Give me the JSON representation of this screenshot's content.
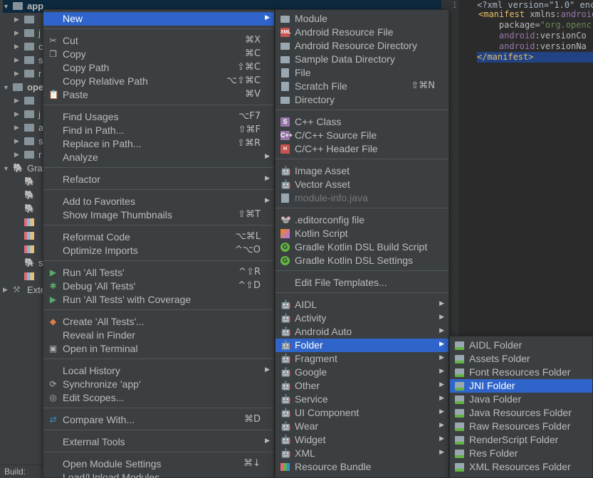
{
  "tree": {
    "rows": [
      {
        "label": "app",
        "kind": "module"
      },
      {
        "label": "",
        "kind": "folder"
      },
      {
        "label": "j",
        "kind": "folder"
      },
      {
        "label": "c",
        "kind": "folder"
      },
      {
        "label": "s",
        "kind": "folder"
      },
      {
        "label": "r",
        "kind": "folder"
      },
      {
        "label": "ope",
        "kind": "module"
      },
      {
        "label": "",
        "kind": "folder"
      },
      {
        "label": "j",
        "kind": "folder"
      },
      {
        "label": "a",
        "kind": "folder"
      },
      {
        "label": "s",
        "kind": "folder"
      },
      {
        "label": "r",
        "kind": "folder"
      },
      {
        "label": "Gra",
        "kind": "gradle"
      },
      {
        "label": "",
        "kind": "gradle-file"
      },
      {
        "label": "",
        "kind": "gradle-file"
      },
      {
        "label": "",
        "kind": "gradle-file"
      },
      {
        "label": "",
        "kind": "bars"
      },
      {
        "label": "",
        "kind": "bars"
      },
      {
        "label": "",
        "kind": "bars"
      },
      {
        "label": "s",
        "kind": "gradle-file"
      },
      {
        "label": "",
        "kind": "bars"
      },
      {
        "label": "Exte",
        "kind": "external"
      }
    ]
  },
  "editor": {
    "line_numbers": [
      "1"
    ],
    "lines": [
      {
        "parts": [
          {
            "t": "<?xml version=\"1.0\" enc",
            "c": "plain"
          }
        ]
      },
      {
        "parts": [
          {
            "t": "<manifest ",
            "c": "tag"
          },
          {
            "t": "xmlns:",
            "c": "attr"
          },
          {
            "t": "android",
            "c": "ns"
          }
        ]
      },
      {
        "parts": [
          {
            "t": "    package=",
            "c": "attr"
          },
          {
            "t": "\"org.openc",
            "c": "str"
          }
        ]
      },
      {
        "parts": [
          {
            "t": "    android",
            "c": "ns"
          },
          {
            "t": ":versionCo",
            "c": "attr"
          }
        ]
      },
      {
        "parts": [
          {
            "t": "    android",
            "c": "ns"
          },
          {
            "t": ":versionNa",
            "c": "attr"
          }
        ]
      },
      {
        "parts": [
          {
            "t": "</manifest>",
            "c": "tag"
          }
        ]
      }
    ]
  },
  "bottombar": {
    "build_label": "Build:"
  },
  "context_menu": {
    "items": [
      {
        "label": "New",
        "icon": "",
        "shortcut": "",
        "submenu": true,
        "active": true
      },
      {
        "sep": true
      },
      {
        "label": "Cut",
        "icon": "scissors-icon",
        "shortcut": "⌘X"
      },
      {
        "label": "Copy",
        "icon": "copy-icon",
        "shortcut": "⌘C"
      },
      {
        "label": "Copy Path",
        "icon": "",
        "shortcut": "⇧⌘C"
      },
      {
        "label": "Copy Relative Path",
        "icon": "",
        "shortcut": "⌥⇧⌘C"
      },
      {
        "label": "Paste",
        "icon": "paste-icon",
        "shortcut": "⌘V"
      },
      {
        "sep": true
      },
      {
        "label": "Find Usages",
        "icon": "",
        "shortcut": "⌥F7"
      },
      {
        "label": "Find in Path...",
        "icon": "",
        "shortcut": "⇧⌘F"
      },
      {
        "label": "Replace in Path...",
        "icon": "",
        "shortcut": "⇧⌘R"
      },
      {
        "label": "Analyze",
        "icon": "",
        "shortcut": "",
        "submenu": true
      },
      {
        "sep": true
      },
      {
        "label": "Refactor",
        "icon": "",
        "shortcut": "",
        "submenu": true
      },
      {
        "sep": true
      },
      {
        "label": "Add to Favorites",
        "icon": "",
        "shortcut": "",
        "submenu": true
      },
      {
        "label": "Show Image Thumbnails",
        "icon": "",
        "shortcut": "⇧⌘T"
      },
      {
        "sep": true
      },
      {
        "label": "Reformat Code",
        "icon": "",
        "shortcut": "⌥⌘L"
      },
      {
        "label": "Optimize Imports",
        "icon": "",
        "shortcut": "^⌥O"
      },
      {
        "sep": true
      },
      {
        "label": "Run 'All Tests'",
        "icon": "run-icon",
        "shortcut": "^⇧R"
      },
      {
        "label": "Debug 'All Tests'",
        "icon": "debug-icon",
        "shortcut": "^⇧D"
      },
      {
        "label": "Run 'All Tests' with Coverage",
        "icon": "coverage-icon",
        "shortcut": ""
      },
      {
        "sep": true
      },
      {
        "label": "Create 'All Tests'...",
        "icon": "create-test-icon",
        "shortcut": ""
      },
      {
        "label": "Reveal in Finder",
        "icon": "",
        "shortcut": ""
      },
      {
        "label": "Open in Terminal",
        "icon": "terminal-icon",
        "shortcut": ""
      },
      {
        "sep": true
      },
      {
        "label": "Local History",
        "icon": "",
        "shortcut": "",
        "submenu": true
      },
      {
        "label": "Synchronize 'app'",
        "icon": "sync-icon",
        "shortcut": ""
      },
      {
        "label": "Edit Scopes...",
        "icon": "scopes-icon",
        "shortcut": ""
      },
      {
        "sep": true
      },
      {
        "label": "Compare With...",
        "icon": "compare-icon",
        "shortcut": "⌘D"
      },
      {
        "sep": true
      },
      {
        "label": "External Tools",
        "icon": "",
        "shortcut": "",
        "submenu": true
      },
      {
        "sep": true
      },
      {
        "label": "Open Module Settings",
        "icon": "",
        "shortcut": "⌘↓"
      },
      {
        "label": "Load/Unload Modules...",
        "icon": "",
        "shortcut": ""
      }
    ]
  },
  "new_menu": {
    "items": [
      {
        "label": "Module",
        "icon": "module-icon",
        "shortcut": ""
      },
      {
        "label": "Android Resource File",
        "icon": "android-resource-file-icon",
        "shortcut": ""
      },
      {
        "label": "Android Resource Directory",
        "icon": "folder-icon",
        "shortcut": ""
      },
      {
        "label": "Sample Data Directory",
        "icon": "folder-icon",
        "shortcut": ""
      },
      {
        "label": "File",
        "icon": "file-icon",
        "shortcut": ""
      },
      {
        "label": "Scratch File",
        "icon": "scratch-file-icon",
        "shortcut": "⇧⌘N"
      },
      {
        "label": "Directory",
        "icon": "folder-icon",
        "shortcut": ""
      },
      {
        "sep": true
      },
      {
        "label": "C++ Class",
        "icon": "cpp-class-icon",
        "shortcut": ""
      },
      {
        "label": "C/C++ Source File",
        "icon": "cpp-source-icon",
        "shortcut": ""
      },
      {
        "label": "C/C++ Header File",
        "icon": "cpp-header-icon",
        "shortcut": ""
      },
      {
        "sep": true
      },
      {
        "label": "Image Asset",
        "icon": "android-icon",
        "shortcut": ""
      },
      {
        "label": "Vector Asset",
        "icon": "android-icon",
        "shortcut": ""
      },
      {
        "label": "module-info.java",
        "icon": "java-file-icon",
        "shortcut": "",
        "disabled": true
      },
      {
        "sep": true
      },
      {
        "label": ".editorconfig file",
        "icon": "editorconfig-icon",
        "shortcut": ""
      },
      {
        "label": "Kotlin Script",
        "icon": "kotlin-icon",
        "shortcut": ""
      },
      {
        "label": "Gradle Kotlin DSL Build Script",
        "icon": "gradle-icon",
        "shortcut": ""
      },
      {
        "label": "Gradle Kotlin DSL Settings",
        "icon": "gradle-icon",
        "shortcut": ""
      },
      {
        "sep": true
      },
      {
        "label": "Edit File Templates...",
        "icon": "",
        "shortcut": ""
      },
      {
        "sep": true
      },
      {
        "label": "AIDL",
        "icon": "android-icon",
        "shortcut": "",
        "submenu": true
      },
      {
        "label": "Activity",
        "icon": "android-icon",
        "shortcut": "",
        "submenu": true
      },
      {
        "label": "Android Auto",
        "icon": "android-icon",
        "shortcut": "",
        "submenu": true
      },
      {
        "label": "Folder",
        "icon": "android-icon",
        "shortcut": "",
        "submenu": true,
        "active": true
      },
      {
        "label": "Fragment",
        "icon": "android-icon",
        "shortcut": "",
        "submenu": true
      },
      {
        "label": "Google",
        "icon": "android-icon",
        "shortcut": "",
        "submenu": true
      },
      {
        "label": "Other",
        "icon": "android-icon",
        "shortcut": "",
        "submenu": true
      },
      {
        "label": "Service",
        "icon": "android-icon",
        "shortcut": "",
        "submenu": true
      },
      {
        "label": "UI Component",
        "icon": "android-icon",
        "shortcut": "",
        "submenu": true
      },
      {
        "label": "Wear",
        "icon": "android-icon",
        "shortcut": "",
        "submenu": true
      },
      {
        "label": "Widget",
        "icon": "android-icon",
        "shortcut": "",
        "submenu": true
      },
      {
        "label": "XML",
        "icon": "android-icon",
        "shortcut": "",
        "submenu": true
      },
      {
        "label": "Resource Bundle",
        "icon": "resource-bundle-icon",
        "shortcut": ""
      }
    ]
  },
  "folder_menu": {
    "items": [
      {
        "label": "AIDL Folder",
        "icon": "android-folder-icon"
      },
      {
        "label": "Assets Folder",
        "icon": "android-folder-icon"
      },
      {
        "label": "Font Resources Folder",
        "icon": "android-folder-icon"
      },
      {
        "label": "JNI Folder",
        "icon": "android-folder-icon",
        "active": true
      },
      {
        "label": "Java Folder",
        "icon": "android-folder-icon"
      },
      {
        "label": "Java Resources Folder",
        "icon": "android-folder-icon"
      },
      {
        "label": "Raw Resources Folder",
        "icon": "android-folder-icon"
      },
      {
        "label": "RenderScript Folder",
        "icon": "android-folder-icon"
      },
      {
        "label": "Res Folder",
        "icon": "android-folder-icon"
      },
      {
        "label": "XML Resources Folder",
        "icon": "android-folder-icon"
      }
    ]
  },
  "colors": {
    "menu_bg": "#3c3f41",
    "selection": "#2f65ca",
    "text": "#bbbbbb",
    "android_green": "#a4c639"
  }
}
